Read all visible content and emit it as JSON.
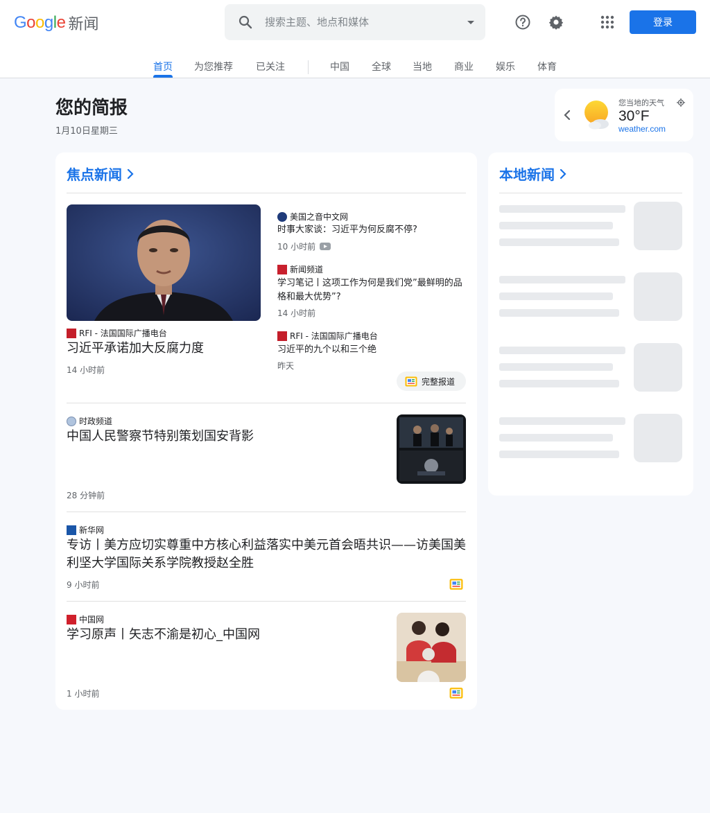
{
  "header": {
    "logo_google": "Google",
    "logo_suffix": "新闻",
    "search_placeholder": "搜索主题、地点和媒体",
    "signin_label": "登录"
  },
  "tabs": [
    {
      "label": "首页"
    },
    {
      "label": "为您推荐"
    },
    {
      "label": "已关注"
    },
    {
      "label": "中国"
    },
    {
      "label": "全球"
    },
    {
      "label": "当地"
    },
    {
      "label": "商业"
    },
    {
      "label": "娱乐"
    },
    {
      "label": "体育"
    }
  ],
  "briefing": {
    "title": "您的简报",
    "date": "1月10日星期三"
  },
  "weather": {
    "label": "您当地的天气",
    "temp": "30°F",
    "source": "weather.com"
  },
  "top_stories": {
    "title": "焦点新闻",
    "featured": {
      "source": "RFI - 法国国际广播电台",
      "headline": "习近平承诺加大反腐力度",
      "time": "14 小时前"
    },
    "related": [
      {
        "source": "美国之音中文网",
        "headline": "时事大家谈：习近平为何反腐不停?",
        "time": "10 小时前"
      },
      {
        "source": "新闻频道",
        "headline": "学习笔记丨这项工作为何是我们党”最鲜明的品格和最大优势”?",
        "time": "14 小时前"
      },
      {
        "source": "RFI - 法国国际广播电台",
        "headline": "习近平的九个以和三个绝",
        "time": "昨天"
      }
    ],
    "full_coverage_label": "完整报道",
    "stories": [
      {
        "source": "时政频道",
        "headline": "中国人民警察节特别策划国安背影",
        "time": "28 分钟前"
      },
      {
        "source": "新华网",
        "headline": "专访丨美方应切实尊重中方核心利益落实中美元首会晤共识——访美国美利坚大学国际关系学院教授赵全胜",
        "time": "9 小时前"
      },
      {
        "source": "中国网",
        "headline": "学习原声丨矢志不渝是初心_中国网",
        "time": "1 小时前"
      }
    ]
  },
  "local_news": {
    "title": "本地新闻"
  },
  "colors": {
    "accent": "#1a73e8",
    "background": "#f6f8fc"
  }
}
